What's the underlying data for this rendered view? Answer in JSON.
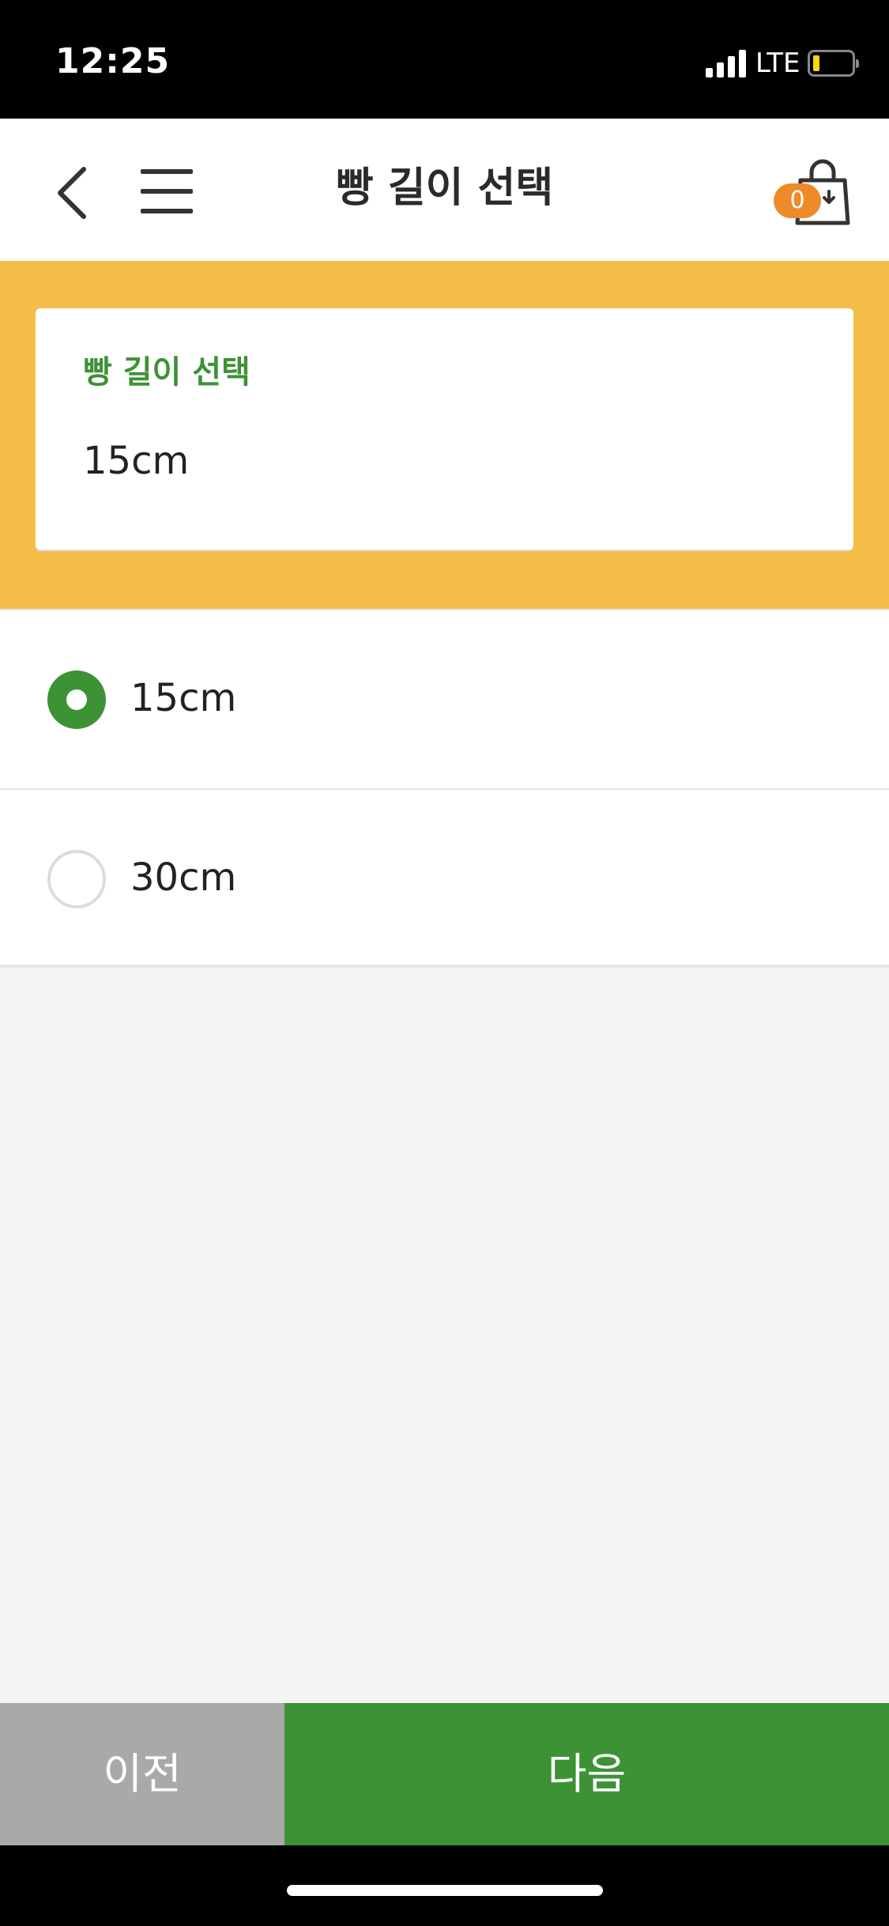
{
  "status_bar": {
    "time": "12:25",
    "network": "LTE",
    "battery_color": "#ffd60a"
  },
  "nav": {
    "title": "빵 길이 선택",
    "back_icon": "chevron-left-icon",
    "menu_icon": "hamburger-menu-icon",
    "cart_icon": "shopping-bag-icon",
    "cart_count": "0"
  },
  "summary": {
    "label": "빵 길이 선택",
    "value": "15cm",
    "label_color": "#3d9236",
    "band_color": "#f4bd47"
  },
  "options": [
    {
      "label": "15cm",
      "selected": true
    },
    {
      "label": "30cm",
      "selected": false
    }
  ],
  "footer": {
    "prev_label": "이전",
    "next_label": "다음",
    "prev_color": "#a9a9a9",
    "next_color": "#3d9236"
  }
}
